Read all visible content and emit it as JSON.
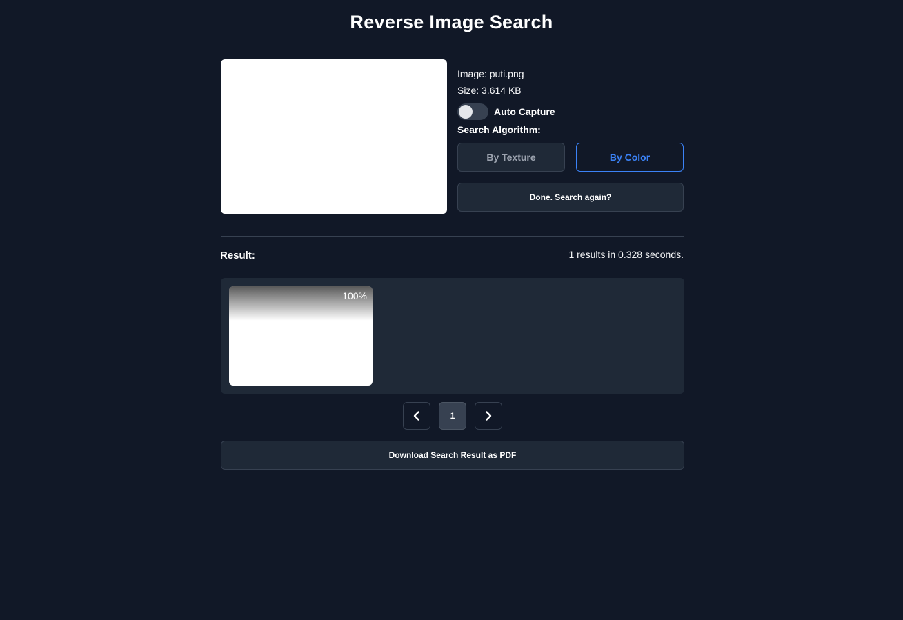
{
  "header": {
    "title": "Reverse Image Search"
  },
  "upload": {
    "image_line": "Image: puti.png",
    "size_line": "Size: 3.614 KB",
    "auto_capture_label": "Auto Capture",
    "auto_capture_on": false,
    "algorithm_label": "Search Algorithm:",
    "algorithms": [
      {
        "label": "By Texture",
        "active": false
      },
      {
        "label": "By Color",
        "active": true
      }
    ],
    "search_again_label": "Done. Search again?"
  },
  "results": {
    "label": "Result:",
    "stats": "1 results in 0.328 seconds.",
    "items": [
      {
        "score": "100%"
      }
    ]
  },
  "pagination": {
    "current_page": "1",
    "prev_icon": "chevron-left-icon",
    "next_icon": "chevron-right-icon"
  },
  "download": {
    "label": "Download Search Result as PDF"
  },
  "colors": {
    "background": "#111827",
    "panel": "#1f2937",
    "border": "#374151",
    "accent": "#3b82f6"
  }
}
